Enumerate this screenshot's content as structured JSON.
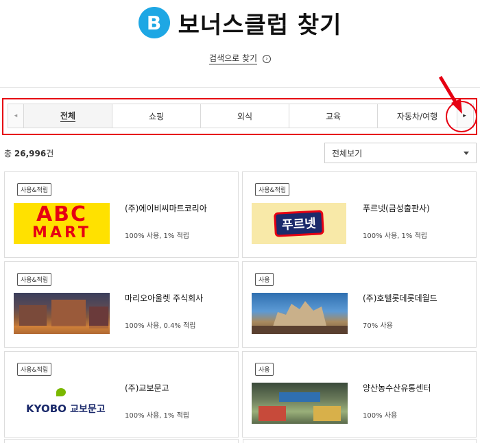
{
  "header": {
    "logo_letter": "B",
    "title": "보너스클럽 찾기",
    "search_link": "검색으로 찾기",
    "search_arrow": "›"
  },
  "tabs": {
    "prev_icon": "◂",
    "next_icon": "▸",
    "items": [
      {
        "label": "전체",
        "active": true
      },
      {
        "label": "쇼핑",
        "active": false
      },
      {
        "label": "외식",
        "active": false
      },
      {
        "label": "교육",
        "active": false
      },
      {
        "label": "자동차/여행",
        "active": false
      }
    ]
  },
  "summary": {
    "count_prefix": "총",
    "count_value": "26,996",
    "count_suffix": "건"
  },
  "sort": {
    "selected": "전체보기"
  },
  "stores": [
    {
      "badge": "사용&적립",
      "name": "(주)에이비씨마트코리아",
      "rate": "100% 사용, 1% 적립",
      "logo_text_1": "ABC",
      "logo_text_2": "MART"
    },
    {
      "badge": "사용&적립",
      "name": "푸르넷(금성출판사)",
      "rate": "100% 사용, 1% 적립",
      "logo_text_1": "푸르넷"
    },
    {
      "badge": "사용&적립",
      "name": "마리오아울렛 주식회사",
      "rate": "100% 사용, 0.4% 적립"
    },
    {
      "badge": "사용",
      "name": "(주)호텔롯데롯데월드",
      "rate": "70% 사용"
    },
    {
      "badge": "사용&적립",
      "name": "(주)교보문고",
      "rate": "100% 사용, 1% 적립",
      "logo_text_1": "KYOBO",
      "logo_text_2": "교보문고"
    },
    {
      "badge": "사용",
      "name": "양산농수산유통센터",
      "rate": "100% 사용"
    }
  ],
  "colors": {
    "accent_blue": "#1ea7e4",
    "highlight_red": "#e60012",
    "abc_red": "#e60012",
    "abc_yellow": "#ffe100"
  }
}
